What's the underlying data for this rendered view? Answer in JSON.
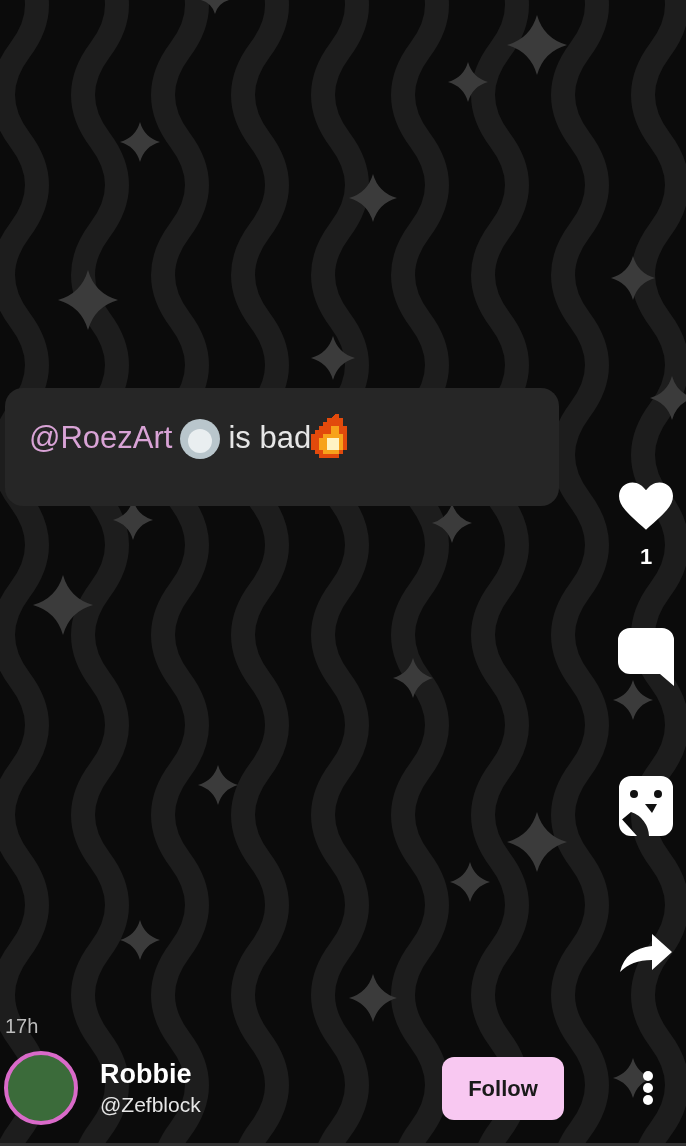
{
  "comment": {
    "mention": "@RoezArt",
    "text": "is bad"
  },
  "actions": {
    "likes": "1"
  },
  "post": {
    "time": "17h"
  },
  "author": {
    "name": "Robbie",
    "handle": "@Zefblock"
  },
  "follow_button": {
    "label": "Follow"
  }
}
